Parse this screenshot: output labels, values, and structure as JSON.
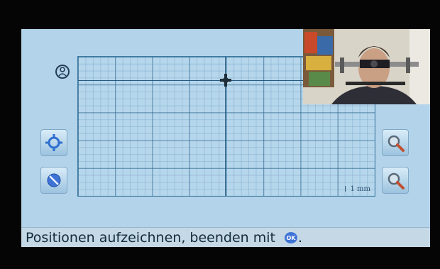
{
  "status": {
    "prefix": "Positionen aufzeichnen, beenden mit",
    "ok_glyph": "OK",
    "suffix": "."
  },
  "grid": {
    "scale_label": "1 mm"
  },
  "icons": {
    "user": "user-circle-icon",
    "center": "center-target-icon",
    "stop": "no-entry-icon",
    "zoom_in": "zoom-in-icon",
    "zoom_out": "zoom-out-icon",
    "marker": "crosshair-marker-icon"
  },
  "colors": {
    "screen_bg": "#b3d3ea",
    "grid_line": "#2f6f96",
    "accent": "#2e6fd0"
  }
}
